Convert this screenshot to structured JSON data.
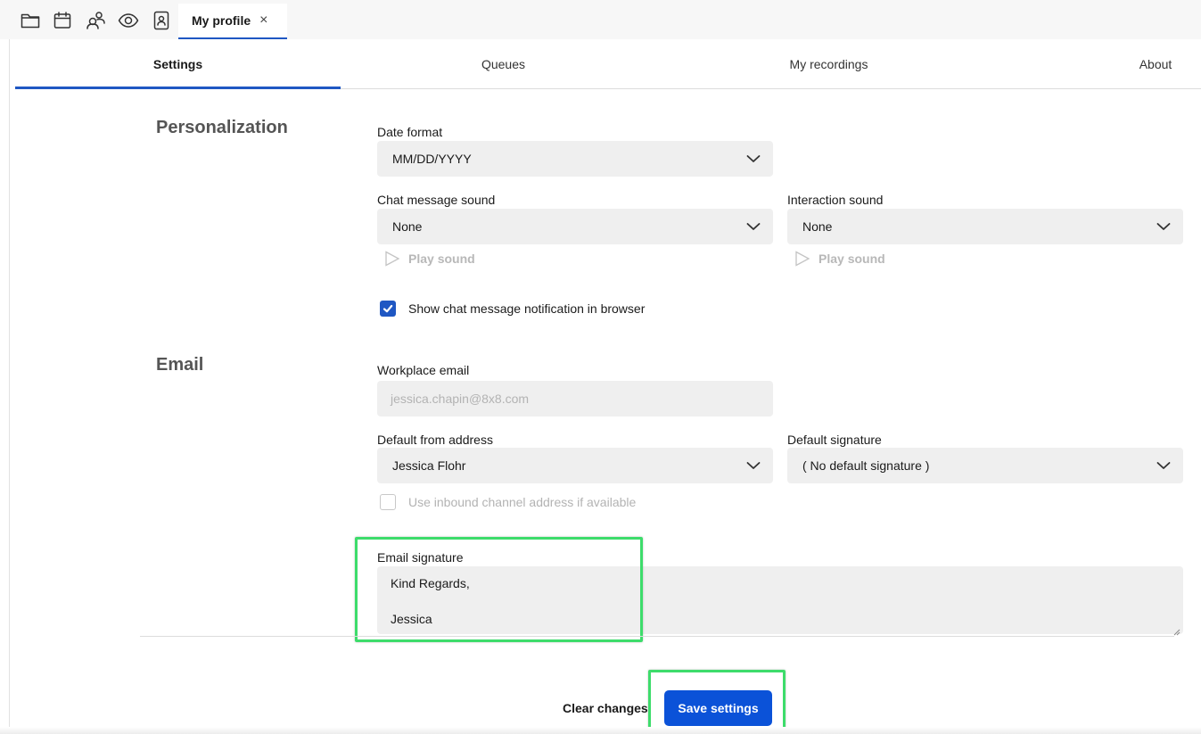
{
  "topbar": {
    "icons": [
      "folder-icon",
      "calendar-icon",
      "people-icon",
      "eye-icon",
      "contact-book-icon"
    ],
    "tab": {
      "label": "My profile",
      "close_icon": "×"
    }
  },
  "nav": {
    "tabs": [
      {
        "label": "Settings",
        "active": true
      },
      {
        "label": "Queues",
        "active": false
      },
      {
        "label": "My recordings",
        "active": false
      },
      {
        "label": "About",
        "active": false
      }
    ]
  },
  "personalization": {
    "title": "Personalization",
    "date_format": {
      "label": "Date format",
      "value": "MM/DD/YYYY"
    },
    "chat_sound": {
      "label": "Chat message sound",
      "value": "None",
      "play_label": "Play sound"
    },
    "interaction_sound": {
      "label": "Interaction sound",
      "value": "None",
      "play_label": "Play sound"
    },
    "notification": {
      "label": "Show chat message notification in browser",
      "checked": true
    }
  },
  "email": {
    "title": "Email",
    "workplace": {
      "label": "Workplace email",
      "value": "jessica.chapin@8x8.com"
    },
    "from_address": {
      "label": "Default from address",
      "value": "Jessica Flohr"
    },
    "signature_default": {
      "label": "Default signature",
      "value": "( No default signature )"
    },
    "inbound": {
      "label": "Use inbound channel address if available",
      "checked": false
    },
    "signature": {
      "label": "Email signature",
      "line1": "Kind Regards,",
      "line2": "Jessica"
    }
  },
  "footer": {
    "clear_label": "Clear changes",
    "save_label": "Save settings"
  },
  "colors": {
    "accent": "#1f57c3",
    "save_button": "#0b52d8",
    "highlight": "#3ddc6b",
    "field_bg": "#efefef"
  }
}
